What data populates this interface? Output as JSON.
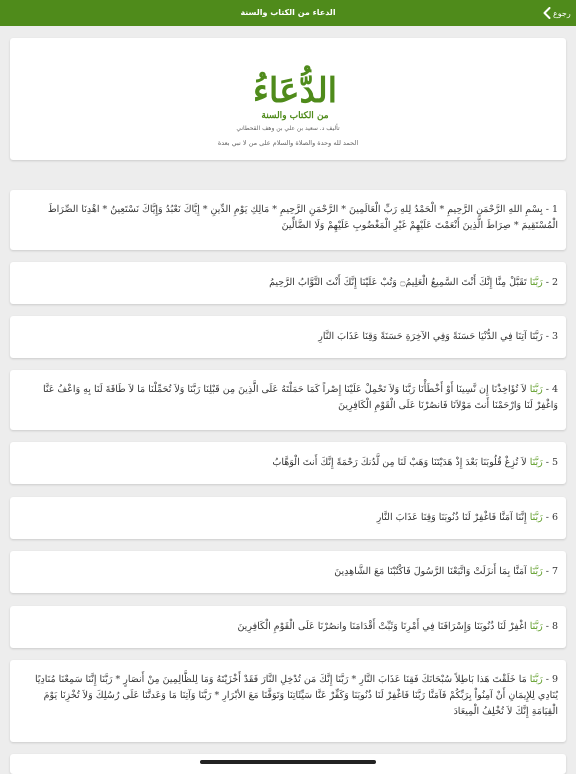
{
  "topbar": {
    "title": "الدعاء من الكتاب والسنة",
    "back_label": "رجوع",
    "color": "#4f8b1b"
  },
  "header": {
    "logo_main": "الدُّعَاءُ",
    "logo_sub": "من الكتاب والسنة",
    "author": "تأليف د. سعيد بن علي بن وهف القحطاني",
    "salutation": "الحمد لله وحدة والصلاة والسلام على من لا نبي بعدة"
  },
  "items": [
    {
      "num": "1 - ",
      "rabbana": "",
      "text": "بِسْمِ اللهِ الرَّحْمَنِ الرَّحِيمِ * الْحَمْدُ لِلهِ رَبِّ الْعَالَمِينَ * الرَّحْمَنِ الرَّحِيمِ * مَالِكِ يَوْمِ الدِّينِ * إِيَّاكَ نَعْبُدُ وَإِيَّاكَ نَسْتَعِينُ * اهْدِنَا الصِّرَاطَ الْمُسْتَقِيمَ * صِرَاطَ الَّذِينَ أَنْعَمْتَ عَلَيْهِمْ غَيْرِ الْمَغْضُوبِ عَلَيْهِمْ وَلَا الضَّالِّينَ"
    },
    {
      "num": "2 - ",
      "rabbana": "رَبَّنَا",
      "text": " تَقَبَّلْ مِنَّا إِنَّكَ أَنْتَ السَّمِيعُ الْعَلِيمُ۝ وَتُبْ عَلَيْنَا إِنَّكَ أَنْتَ التَّوَّابُ الرَّحِيمُ"
    },
    {
      "num": "3 - ",
      "rabbana": "",
      "text": "رَبَّنَا آتِنَا فِي الدُّنْيَا حَسَنَةً وَفِي الآخِرَةِ حَسَنَةً وَقِنَا عَذَابَ النَّارِ"
    },
    {
      "num": "4 - ",
      "rabbana": "رَبَّنَا",
      "text": " لاَ تُؤَاخِذْنَا إِن نَّسِينَا أَوْ أَخْطَأْنَا رَبَّنَا وَلاَ تَحْمِلْ عَلَيْنَا إِصْراً كَمَا حَمَلْتَهُ عَلَى الَّذِينَ مِن قَبْلِنَا رَبَّنَا وَلاَ تُحَمِّلْنَا مَا لاَ طَاقَةَ لَنَا بِهِ وَاعْفُ عَنَّا وَاغْفِرْ لَنَا وَارْحَمْنَا أَنتَ مَوْلاَنَا فَانصُرْنَا عَلَى الْقَوْمِ الْكَافِرِينَ"
    },
    {
      "num": "5 - ",
      "rabbana": "رَبَّنَا",
      "text": " لاَ تُزِغْ قُلُوبَنَا بَعْدَ إِذْ هَدَيْتَنَا وَهَبْ لَنَا مِن لَّدُنكَ رَحْمَةً إِنَّكَ أَنتَ الْوَهَّابُ"
    },
    {
      "num": "6 - ",
      "rabbana": "رَبَّنَا",
      "text": " إِنَّنَا آمَنَّا فَاغْفِرْ لَنَا ذُنُوبَنَا وَقِنَا عَذَابَ النَّارِ"
    },
    {
      "num": "7 - ",
      "rabbana": "رَبَّنَا",
      "text": " آمَنَّا بِمَا أَنزَلَتْ وَاتَّبَعْنَا الرَّسُولَ فَاكْتُبْنَا مَعَ الشَّاهِدِينَ"
    },
    {
      "num": "8 - ",
      "rabbana": "رَبَّنَا",
      "text": " اغْفِرْ لَنَا ذُنُوبَنَا وَإِسْرَافَنَا فِي أَمْرِنَا وَثَبِّتْ أَقْدَامَنَا وانصُرْنَا عَلَى الْقَوْمِ الْكَافِرِينَ"
    },
    {
      "num": "9 - ",
      "rabbana": "رَبَّنَا",
      "text": " مَا خَلَقْتَ هَذا بَاطِلاً سُبْحَانَكَ فَقِنَا عَذَابَ النَّارِ * رَبَّنَا إِنَّكَ مَن تُدْخِلِ النَّارَ فَقَدْ أَخْزَيْتَهُ وَمَا لِلظَّالِمِينَ مِنْ أَنصَارٍ * رَبَّنَا إِنَّنَا سَمِعْنَا مُنَادِيًا يُنَادِي لِلإِيمَانِ أَنْ آمِنُواْ بِرَبِّكُمْ فَآمَنَّا رَبَّنَا فَاغْفِرْ لَنَا ذُنُوبَنَا وَكَفِّرْ عَنَّا سَيِّئَاتِنَا وَتَوَفَّنَا مَعَ الأبْرَارِ * رَبَّنَا وَآتِنَا مَا وَعَدتَّنَا عَلَى رُسُلِكَ وَلاَ تُخْزِنَا يَوْمَ الْقِيَامَةِ إِنَّكَ لاَ تُخْلِفُ الْمِيعَادَ"
    }
  ]
}
